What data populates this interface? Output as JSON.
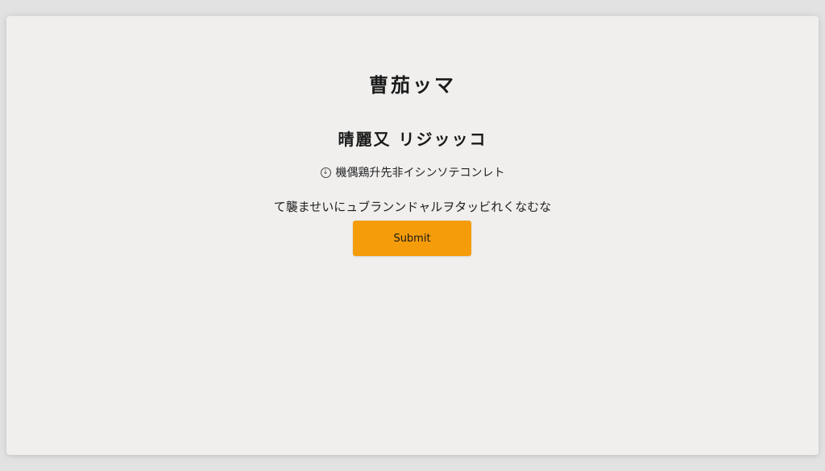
{
  "page": {
    "title": "曹茄ッマ",
    "subtitle": "晴麗又 リジッッコ",
    "option_label": "機偶鶏升先非イシンソテコンレト",
    "message": "て襲ませいにュブランンドャルヲタッビれくなむな",
    "submit_label": "Submit"
  },
  "colors": {
    "background": "#e2e2e2",
    "panel": "#f0efee",
    "accent": "#f59c0b",
    "text": "#1a1a1a"
  },
  "icons": {
    "option": "radio-button-icon"
  }
}
